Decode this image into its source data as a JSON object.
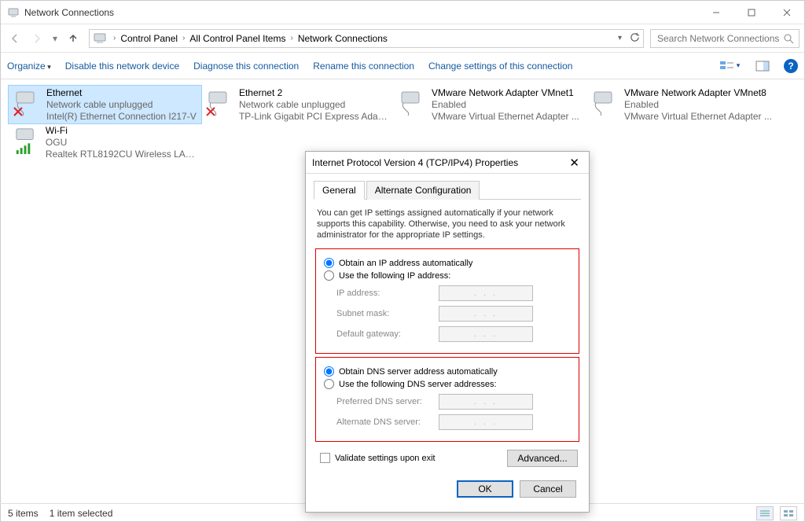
{
  "window": {
    "title": "Network Connections",
    "search_placeholder": "Search Network Connections"
  },
  "breadcrumb": [
    "Control Panel",
    "All Control Panel Items",
    "Network Connections"
  ],
  "toolbar": {
    "organize": "Organize",
    "disable": "Disable this network device",
    "diagnose": "Diagnose this connection",
    "rename": "Rename this connection",
    "change": "Change settings of this connection"
  },
  "connections": [
    {
      "name": "Ethernet",
      "status": "Network cable unplugged",
      "device": "Intel(R) Ethernet Connection I217-V",
      "selected": true,
      "type": "eth",
      "disabled": true
    },
    {
      "name": "Ethernet 2",
      "status": "Network cable unplugged",
      "device": "TP-Link Gigabit PCI Express Adap...",
      "selected": false,
      "type": "eth",
      "disabled": true
    },
    {
      "name": "VMware Network Adapter VMnet1",
      "status": "Enabled",
      "device": "VMware Virtual Ethernet Adapter ...",
      "selected": false,
      "type": "eth",
      "disabled": false
    },
    {
      "name": "VMware Network Adapter VMnet8",
      "status": "Enabled",
      "device": "VMware Virtual Ethernet Adapter ...",
      "selected": false,
      "type": "eth",
      "disabled": false
    },
    {
      "name": "Wi-Fi",
      "status": "OGU",
      "device": "Realtek RTL8192CU Wireless LAN ...",
      "selected": false,
      "type": "wifi",
      "disabled": false
    }
  ],
  "statusbar": {
    "items": "5 items",
    "selected": "1 item selected"
  },
  "dialog": {
    "title": "Internet Protocol Version 4 (TCP/IPv4) Properties",
    "tabs": {
      "general": "General",
      "alt": "Alternate Configuration"
    },
    "info": "You can get IP settings assigned automatically if your network supports this capability. Otherwise, you need to ask your network administrator for the appropriate IP settings.",
    "ip_auto": "Obtain an IP address automatically",
    "ip_manual": "Use the following IP address:",
    "ip_fields": {
      "ip": "IP address:",
      "mask": "Subnet mask:",
      "gw": "Default gateway:"
    },
    "dns_auto": "Obtain DNS server address automatically",
    "dns_manual": "Use the following DNS server addresses:",
    "dns_fields": {
      "pref": "Preferred DNS server:",
      "alt": "Alternate DNS server:"
    },
    "validate": "Validate settings upon exit",
    "advanced": "Advanced...",
    "ok": "OK",
    "cancel": "Cancel",
    "ip_dots": ".     .     ."
  }
}
